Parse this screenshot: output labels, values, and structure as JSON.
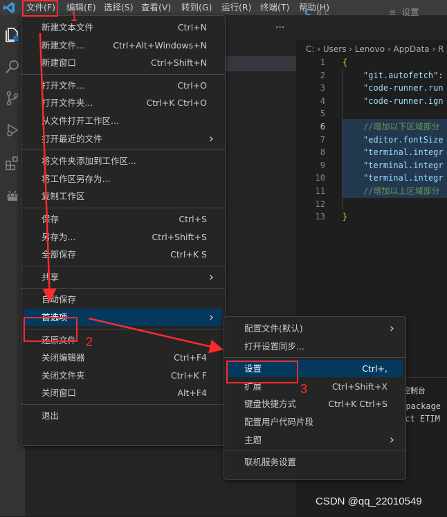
{
  "menubar": {
    "items": [
      "文件(F)",
      "编辑(E)",
      "选择(S)",
      "查看(V)",
      "转到(G)",
      "运行(R)",
      "终端(T)",
      "帮助(H)"
    ]
  },
  "sidebar": {
    "more": "···"
  },
  "tabs": [
    {
      "label": "a.c"
    },
    {
      "label": "设置"
    }
  ],
  "breadcrumb": "C: › Users › Lenovo › AppData › R",
  "editor": {
    "lines": [
      {
        "n": "1",
        "text": "{"
      },
      {
        "n": "2",
        "text": "\"git.autofetch\":"
      },
      {
        "n": "3",
        "text": "\"code-runner.run"
      },
      {
        "n": "4",
        "text": "\"code-runner.ign"
      },
      {
        "n": "5",
        "text": ""
      },
      {
        "n": "6",
        "text": "//增加以下区域部分"
      },
      {
        "n": "7",
        "text": "\"editor.fontSize"
      },
      {
        "n": "8",
        "text": "\"terminal.integr"
      },
      {
        "n": "9",
        "text": "\"terminal.integr"
      },
      {
        "n": "10",
        "text": "\"terminal.integr"
      },
      {
        "n": "11",
        "text": "//增加以上区域部分"
      },
      {
        "n": "12",
        "text": ""
      },
      {
        "n": "13",
        "text": "}"
      }
    ]
  },
  "panel": {
    "tab": "控制台",
    "line1": "m package",
    "line2": "ect ETIM"
  },
  "file_menu": {
    "groups": [
      [
        {
          "label": "新建文本文件",
          "key": "Ctrl+N"
        },
        {
          "label": "新建文件...",
          "key": "Ctrl+Alt+Windows+N"
        },
        {
          "label": "新建窗口",
          "key": "Ctrl+Shift+N"
        }
      ],
      [
        {
          "label": "打开文件...",
          "key": "Ctrl+O"
        },
        {
          "label": "打开文件夹...",
          "key": "Ctrl+K Ctrl+O"
        },
        {
          "label": "从文件打开工作区...",
          "key": ""
        },
        {
          "label": "打开最近的文件",
          "key": "",
          "submenu": true
        }
      ],
      [
        {
          "label": "将文件夹添加到工作区...",
          "key": ""
        },
        {
          "label": "将工作区另存为...",
          "key": ""
        },
        {
          "label": "复制工作区",
          "key": ""
        }
      ],
      [
        {
          "label": "保存",
          "key": "Ctrl+S"
        },
        {
          "label": "另存为...",
          "key": "Ctrl+Shift+S"
        },
        {
          "label": "全部保存",
          "key": "Ctrl+K S"
        }
      ],
      [
        {
          "label": "共享",
          "key": "",
          "submenu": true
        }
      ],
      [
        {
          "label": "自动保存",
          "key": ""
        },
        {
          "label": "首选项",
          "key": "",
          "submenu": true,
          "highlight": true
        }
      ],
      [
        {
          "label": "还原文件",
          "key": ""
        },
        {
          "label": "关闭编辑器",
          "key": "Ctrl+F4"
        },
        {
          "label": "关闭文件夹",
          "key": "Ctrl+K F"
        },
        {
          "label": "关闭窗口",
          "key": "Alt+F4"
        }
      ],
      [
        {
          "label": "退出",
          "key": ""
        }
      ]
    ]
  },
  "pref_menu": {
    "groups": [
      [
        {
          "label": "配置文件(默认)",
          "key": "",
          "submenu": true
        },
        {
          "label": "打开设置同步...",
          "key": ""
        }
      ],
      [
        {
          "label": "设置",
          "key": "Ctrl+,",
          "highlight": true
        },
        {
          "label": "扩展",
          "key": "Ctrl+Shift+X"
        },
        {
          "label": "键盘快捷方式",
          "key": "Ctrl+K Ctrl+S"
        },
        {
          "label": "配置用户代码片段",
          "key": ""
        },
        {
          "label": "主题",
          "key": "",
          "submenu": true
        }
      ],
      [
        {
          "label": "联机服务设置",
          "key": ""
        }
      ]
    ]
  },
  "annotations": {
    "n1": "1",
    "n2": "2",
    "n3": "3"
  },
  "watermark": "CSDN @qq_22010549",
  "colors": {
    "accent": "#04395e",
    "annotation": "#ff2b2b",
    "menu_bg": "#252526"
  }
}
